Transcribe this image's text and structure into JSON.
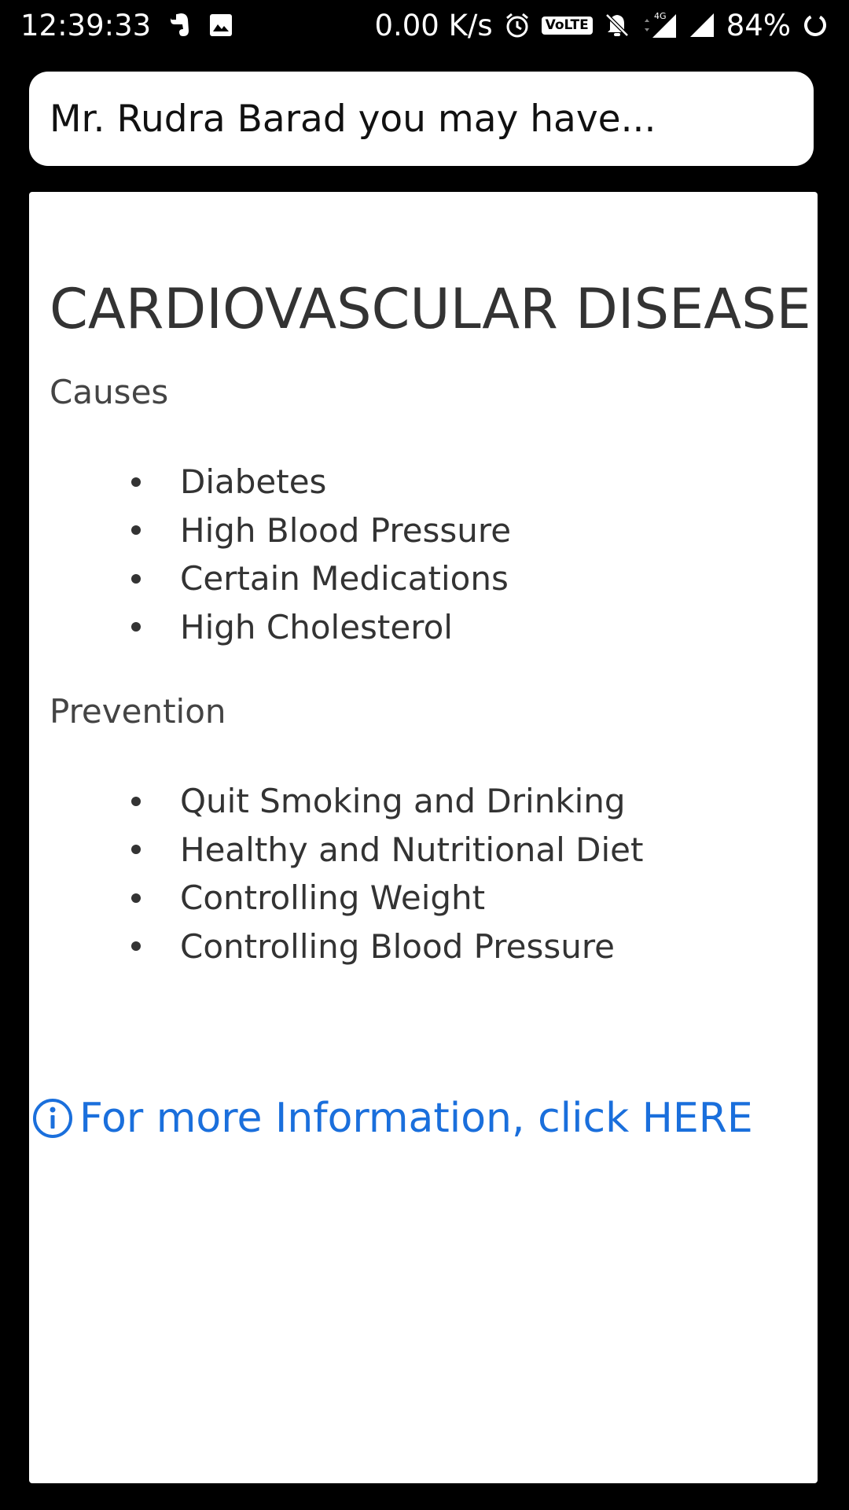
{
  "status_bar": {
    "time": "12:39:33",
    "net_speed": "0.00 K/s",
    "volte": "VoLTE",
    "network_type": "4G",
    "battery": "84%"
  },
  "header": {
    "title": "Mr. Rudra Barad you may have..."
  },
  "content": {
    "disease_title": "CARDIOVASCULAR DISEASE",
    "causes_heading": "Causes",
    "causes": [
      "Diabetes",
      "High Blood Pressure",
      "Certain Medications",
      "High Cholesterol"
    ],
    "prevention_heading": "Prevention",
    "prevention": [
      "Quit Smoking and Drinking",
      "Healthy and Nutritional Diet",
      "Controlling Weight",
      "Controlling Blood Pressure"
    ],
    "more_info_link": "For more Information, click HERE",
    "link_color": "#1a6fdc"
  },
  "icons": {
    "status_left": [
      "evernote-icon",
      "image-icon"
    ],
    "status_right": [
      "alarm-icon",
      "volte-icon",
      "notifications-off-icon",
      "signal-4g-icon",
      "signal-icon",
      "battery-ring-icon"
    ],
    "info": "info-icon"
  }
}
